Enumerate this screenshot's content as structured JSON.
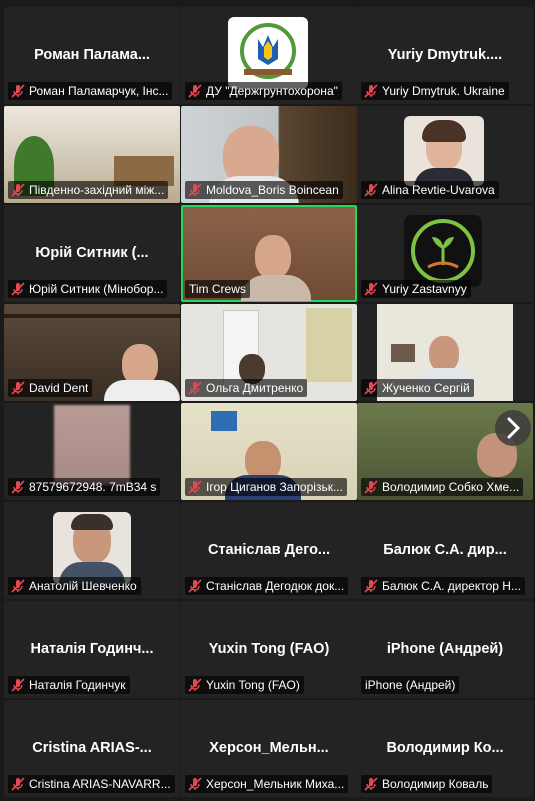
{
  "tiles": [
    {
      "id": "t1",
      "name": "Роман Паламарчук, Інс...",
      "display": "Роман  Палама...",
      "muted": true
    },
    {
      "id": "t2",
      "name": "ДУ \"Держгрунтохорона\"",
      "display": "",
      "muted": true
    },
    {
      "id": "t3",
      "name": "Yuriy Dmytruk. Ukraine",
      "display": "Yuriy  Dmytruk....",
      "muted": true
    },
    {
      "id": "t4",
      "name": "Південно-західний між...",
      "display": "",
      "muted": true
    },
    {
      "id": "t5",
      "name": "Moldova_Boris Boincean",
      "display": "",
      "muted": true
    },
    {
      "id": "t6",
      "name": "Alina Revtie-Uvarova",
      "display": "",
      "muted": true
    },
    {
      "id": "t7",
      "name": "Юрій Ситник (Мінобор...",
      "display": "Юрій  Ситник  (...",
      "muted": true
    },
    {
      "id": "t8",
      "name": "Tim Crews",
      "display": "",
      "muted": false
    },
    {
      "id": "t9",
      "name": "Yuriy Zastavnyy",
      "display": "",
      "muted": true
    },
    {
      "id": "t10",
      "name": "David Dent",
      "display": "",
      "muted": true
    },
    {
      "id": "t11",
      "name": "Ольга Дмитренко",
      "display": "",
      "muted": true
    },
    {
      "id": "t12",
      "name": "Жученко Сергій",
      "display": "",
      "muted": true
    },
    {
      "id": "t13",
      "name": "87579672948.   7mB34 s",
      "display": "",
      "muted": true
    },
    {
      "id": "t14",
      "name": "Ігор Циганов Запорізьк...",
      "display": "",
      "muted": true
    },
    {
      "id": "t15",
      "name": "Володимир Собко Хме...",
      "display": "",
      "muted": true
    },
    {
      "id": "t16",
      "name": "Анатолій Шевченко",
      "display": "",
      "muted": true
    },
    {
      "id": "t17",
      "name": "Станіслав Дегодюк док...",
      "display": "Станіслав  Дего...",
      "muted": true
    },
    {
      "id": "t18",
      "name": "Балюк С.А. директор Н...",
      "display": "Балюк  С.А.  дир...",
      "muted": true
    },
    {
      "id": "t19",
      "name": "Наталія Годинчук",
      "display": "Наталія  Годинч...",
      "muted": true
    },
    {
      "id": "t20",
      "name": "Yuxin Tong (FAO)",
      "display": "Yuxin Tong (FAO)",
      "muted": true
    },
    {
      "id": "t21",
      "name": "iPhone (Андрей)",
      "display": "iPhone (Андрей)",
      "muted": false
    },
    {
      "id": "t22",
      "name": "Cristina ARIAS-NAVARR...",
      "display": "Cristina  ARIAS-...",
      "muted": true
    },
    {
      "id": "t23",
      "name": "Херсон_Мельник Миха...",
      "display": "Херсон_Мельн...",
      "muted": true
    },
    {
      "id": "t24",
      "name": "Володимир Коваль",
      "display": "Володимир  Ко...",
      "muted": true
    }
  ],
  "icons": {
    "muted": "mic-muted-icon",
    "next": "chevron-right-icon"
  },
  "colors": {
    "active_speaker_border": "#23d959",
    "muted_mic": "#e5484d",
    "tile_bg": "#232323",
    "page_bg": "#1a1a1a"
  }
}
